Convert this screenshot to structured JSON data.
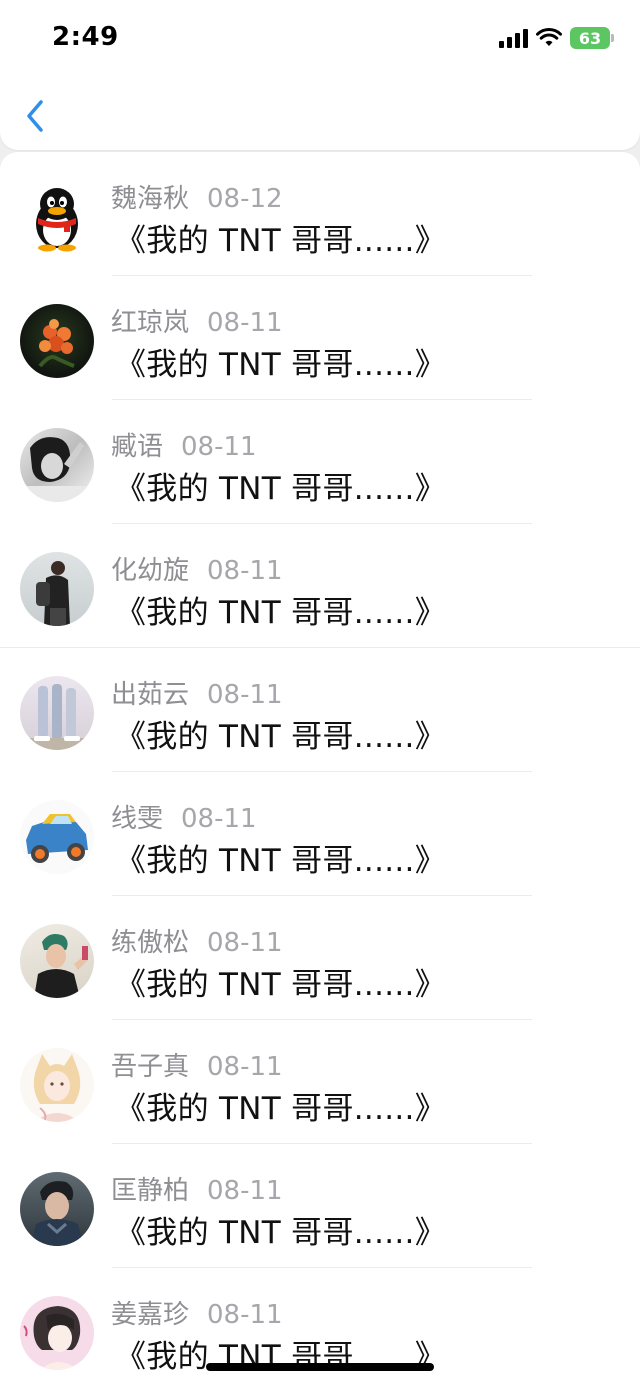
{
  "status_bar": {
    "time": "2:49",
    "battery": "63",
    "battery_color": "#5cc663"
  },
  "nav": {
    "back_icon": "chevron-left-icon",
    "accent": "#2f8fe8"
  },
  "messages": [
    {
      "name": "魏海秋",
      "date": "08-12",
      "text": "《我的 TNT 哥哥......》",
      "avatar": "penguin-icon"
    },
    {
      "name": "红琼岚",
      "date": "08-11",
      "text": "《我的 TNT 哥哥......》",
      "avatar": "flower-photo"
    },
    {
      "name": "臧语",
      "date": "08-11",
      "text": "《我的 TNT 哥哥......》",
      "avatar": "bw-girl-photo"
    },
    {
      "name": "化幼旋",
      "date": "08-11",
      "text": "《我的 TNT 哥哥......》",
      "avatar": "person-backpack-photo"
    },
    {
      "name": "出茹云",
      "date": "08-11",
      "text": "《我的 TNT 哥哥......》",
      "avatar": "legs-photo"
    },
    {
      "name": "线雯",
      "date": "08-11",
      "text": "《我的 TNT 哥哥......》",
      "avatar": "toy-car-image"
    },
    {
      "name": "练傲松",
      "date": "08-11",
      "text": "《我的 TNT 哥哥......》",
      "avatar": "man-photo"
    },
    {
      "name": "吾子真",
      "date": "08-11",
      "text": "《我的 TNT 哥哥......》",
      "avatar": "cat-girl-illustration"
    },
    {
      "name": "匡静柏",
      "date": "08-11",
      "text": "《我的 TNT 哥哥......》",
      "avatar": "male-model-photo"
    },
    {
      "name": "姜嘉珍",
      "date": "08-11",
      "text": "《我的 TNT 哥哥......》",
      "avatar": "girl-drawing"
    }
  ]
}
